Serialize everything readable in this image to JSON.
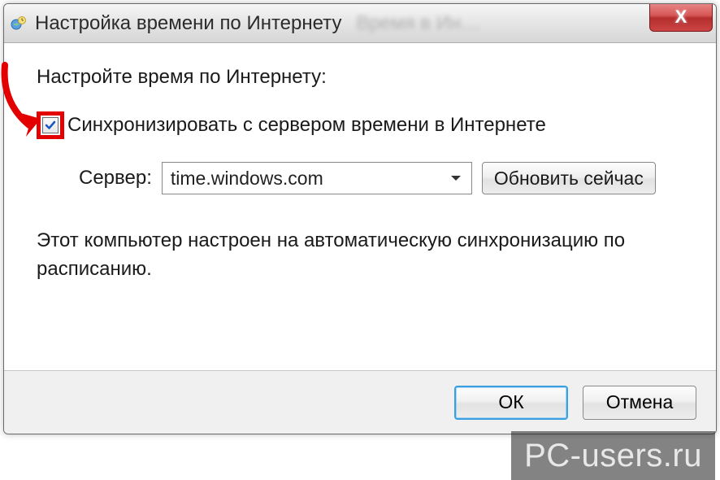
{
  "window": {
    "title": "Настройка времени по Интернету"
  },
  "content": {
    "heading": "Настройте время по Интернету:",
    "checkbox_label": "Синхронизировать с сервером времени в Интернете",
    "checkbox_checked": true,
    "server_label": "Сервер:",
    "server_value": "time.windows.com",
    "update_button": "Обновить сейчас",
    "status": "Этот компьютер настроен на автоматическую синхронизацию по расписанию."
  },
  "footer": {
    "ok": "ОК",
    "cancel": "Отмена"
  },
  "watermark": "PC-users.ru"
}
